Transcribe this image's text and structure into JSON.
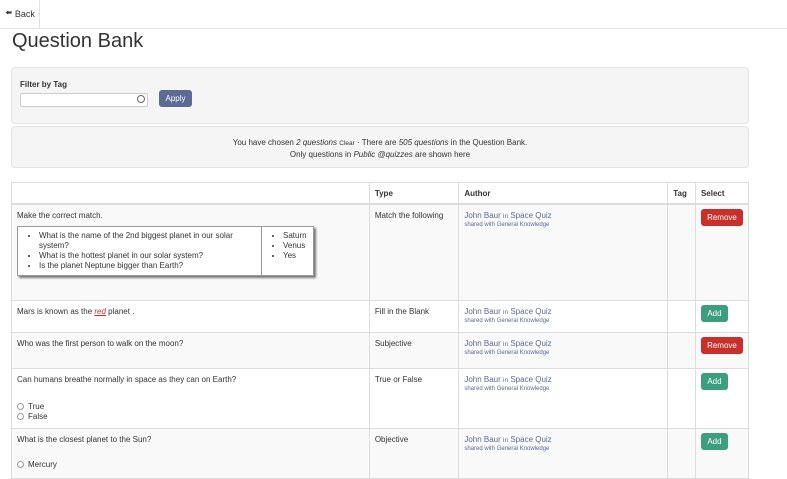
{
  "nav": {
    "back_label": "Back"
  },
  "page": {
    "title": "Question Bank"
  },
  "filter": {
    "label": "Filter by Tag",
    "input_value": "",
    "apply_label": "Apply"
  },
  "info": {
    "line1_prefix": "You have chosen",
    "chosen": "2 questions",
    "clear": "Clear",
    "line1_mid": "· There are",
    "total": "505 questions",
    "line1_suffix": "in the Question Bank.",
    "line2_prefix": "Only questions in",
    "scope": "Public @quizzes",
    "line2_suffix": "are shown here"
  },
  "table": {
    "headers": {
      "question": "",
      "type": "Type",
      "author": "Author",
      "tag": "Tag",
      "select": "Select"
    },
    "rows": [
      {
        "question": "Make the correct match.",
        "match_left": [
          "What is the name of the 2nd biggest planet in our solar system?",
          "What is the hottest planet in our solar system?",
          "Is the planet Neptune bigger than Earth?"
        ],
        "match_right": [
          "Saturn",
          "Venus",
          "Yes"
        ],
        "type": "Match the following",
        "author": "John Baur",
        "in": "in",
        "quiz": "Space Quiz",
        "shared_prefix": "shared with",
        "shared_with": "General Knowledge",
        "tag": "",
        "action": "Remove"
      },
      {
        "question_pre": "Mars is known as the",
        "blank": "red",
        "question_post": "planet .",
        "type": "Fill in the Blank",
        "author": "John Baur",
        "in": "in",
        "quiz": "Space Quiz",
        "shared_prefix": "shared with",
        "shared_with": "General Knowledge",
        "tag": "",
        "action": "Add"
      },
      {
        "question": "Who was the first person to walk on the moon?",
        "type": "Subjective",
        "author": "John Baur",
        "in": "in",
        "quiz": "Space Quiz",
        "shared_prefix": "shared with",
        "shared_with": "General Knowledge",
        "tag": "",
        "action": "Remove"
      },
      {
        "question": "Can humans breathe normally in space as they can on Earth?",
        "options": [
          "True",
          "False"
        ],
        "type": "True or False",
        "author": "John Baur",
        "in": "in",
        "quiz": "Space Quiz",
        "shared_prefix": "shared with",
        "shared_with": "General Knowledge",
        "tag": "",
        "action": "Add"
      },
      {
        "question": "What is the closest planet to the Sun?",
        "options": [
          "Mercury"
        ],
        "type": "Objective",
        "author": "John Baur",
        "in": "in",
        "quiz": "Space Quiz",
        "shared_prefix": "shared with",
        "shared_with": "General Knowledge",
        "tag": "",
        "action": "Add"
      }
    ]
  },
  "colors": {
    "remove": "#c9302c",
    "add": "#3c9e7f",
    "apply": "#5b6b94",
    "link": "#5b6b94"
  }
}
